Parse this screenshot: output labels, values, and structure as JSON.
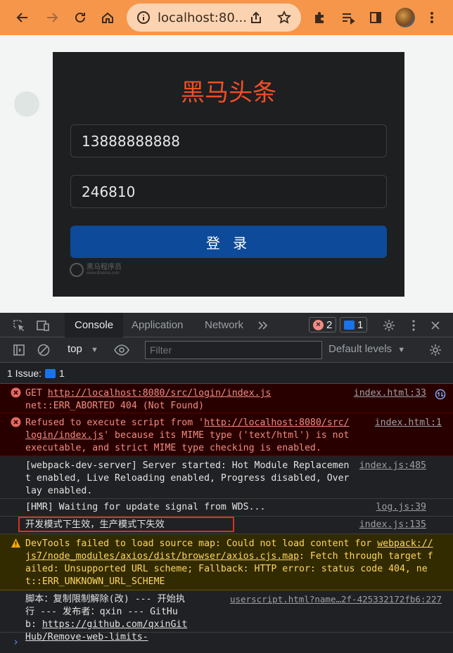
{
  "browser": {
    "url": "localhost:80...",
    "colors": {
      "toolbar": "#f6964a",
      "omnibox": "#fbd3b1"
    }
  },
  "login": {
    "title": "黑马头条",
    "phone_value": "13888888888",
    "code_value": "246810",
    "submit_label": "登 录",
    "watermark_text": "黑马程序员",
    "watermark_sub": "www.itheima.com",
    "colors": {
      "title": "#f04e27",
      "button": "#0d4a99",
      "card": "#1d1f21"
    }
  },
  "devtools": {
    "tabs": [
      "Console",
      "Application",
      "Network"
    ],
    "active_tab": "Console",
    "error_count": "2",
    "message_count": "1",
    "context": "top",
    "filter_placeholder": "Filter",
    "levels_label": "Default levels",
    "issues_label": "1 Issue:",
    "issues_count": "1",
    "messages": [
      {
        "type": "error",
        "text_a": "GET ",
        "link": "http://localhost:8080/src/login/index.js",
        "text_b": "\nnet::ERR_ABORTED 404 (Not Found)",
        "source": "index.html:33"
      },
      {
        "type": "error",
        "text_a": "Refused to execute script from '",
        "link": "http://localhost:8080/src/login/index.js",
        "text_b": "' because its MIME type ('text/html') is not executable, and strict MIME type checking is enabled.",
        "source": "index.html:1"
      },
      {
        "type": "info",
        "text": "[webpack-dev-server] Server started: Hot Module Replacement enabled, Live Reloading enabled, Progress disabled, Overlay enabled.",
        "source": "index.js:485"
      },
      {
        "type": "info",
        "text": "[HMR] Waiting for update signal from WDS...",
        "source": "log.js:39"
      },
      {
        "type": "log",
        "text": "开发模式下生效，生产模式下失效",
        "source": "index.js:135"
      },
      {
        "type": "warn",
        "text_a": "DevTools failed to load source map: Could not load content for ",
        "link": "webpack://js7/node_modules/axios/dist/browser/axios.cjs.map",
        "text_b": ": Fetch through target failed: Unsupported URL scheme; Fallback: HTTP error: status code 404, net::ERR_UNKNOWN_URL_SCHEME",
        "source": ""
      },
      {
        "type": "log",
        "text_a": "脚本：复制限制解除(改) --- 开始执行 --- 发布者：qxin --- GitHub: ",
        "link": "https://github.com/qxinGitHub/Remove-web-limits-",
        "source": "userscript.html?name…2f-425332172fb6:227"
      }
    ],
    "colors": {
      "error_bg": "#290000",
      "error_text": "#f28b82",
      "warn_bg": "#332b00",
      "warn_text": "#fdd663",
      "highlight": "#d93025"
    }
  }
}
